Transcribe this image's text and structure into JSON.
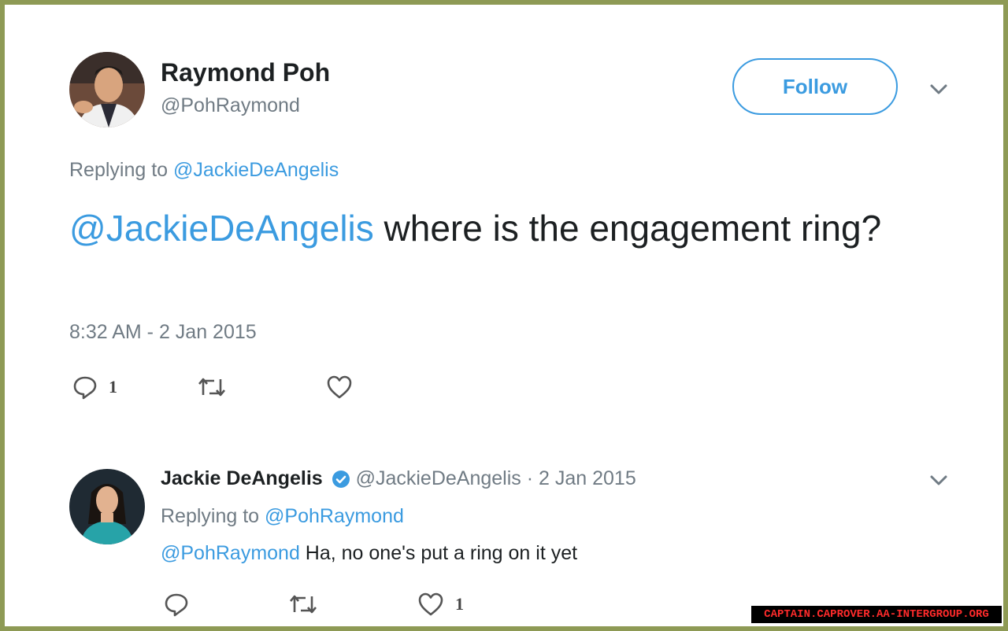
{
  "main_tweet": {
    "author_name": "Raymond Poh",
    "author_handle": "@PohRaymond",
    "follow_label": "Follow",
    "replying_prefix": "Replying to",
    "replying_to": "@JackieDeAngelis",
    "text_mention": "@JackieDeAngelis",
    "text_body": " where is the engagement ring?",
    "timestamp": "8:32 AM - 2 Jan 2015",
    "reply_count": "1"
  },
  "reply_tweet": {
    "author_name": "Jackie DeAngelis",
    "author_handle": "@JackieDeAngelis",
    "separator": " · ",
    "date": "2 Jan 2015",
    "replying_prefix": "Replying to",
    "replying_to": "@PohRaymond",
    "text_mention": "@PohRaymond",
    "text_body": " Ha, no one's put a ring on it yet",
    "like_count": "1"
  },
  "watermark": "CAPTAIN.CAPROVER.AA-INTERGROUP.ORG",
  "colors": {
    "link": "#3b9be0",
    "border": "#8e9a55",
    "text": "#1c2022",
    "muted": "#707b84"
  }
}
